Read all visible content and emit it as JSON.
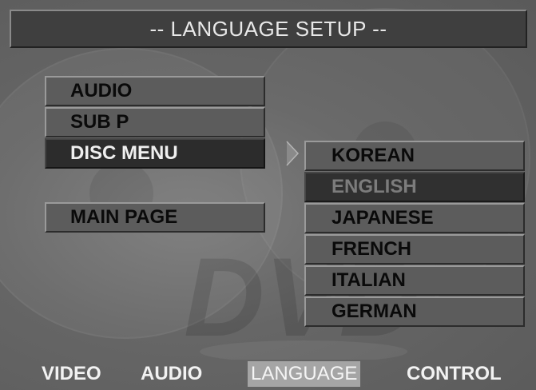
{
  "title": "-- LANGUAGE SETUP --",
  "left_menu": {
    "items": [
      "AUDIO",
      "SUB P",
      "DISC MENU"
    ],
    "selected_label": "DISC MENU",
    "main_page": "MAIN PAGE"
  },
  "language_options": {
    "items": [
      "KOREAN",
      "ENGLISH",
      "JAPANESE",
      "FRENCH",
      "ITALIAN",
      "GERMAN"
    ],
    "highlighted": "ENGLISH"
  },
  "bottom_tabs": {
    "items": [
      "VIDEO",
      "AUDIO",
      "LANGUAGE",
      "CONTROL"
    ],
    "active": "LANGUAGE"
  },
  "icons": {
    "arrow": "chevron-right-icon",
    "watermark": "dvd-logo"
  },
  "colors": {
    "background": "#666666",
    "selected": "#2c2c2c",
    "active_tab": "#a5a5a5"
  }
}
